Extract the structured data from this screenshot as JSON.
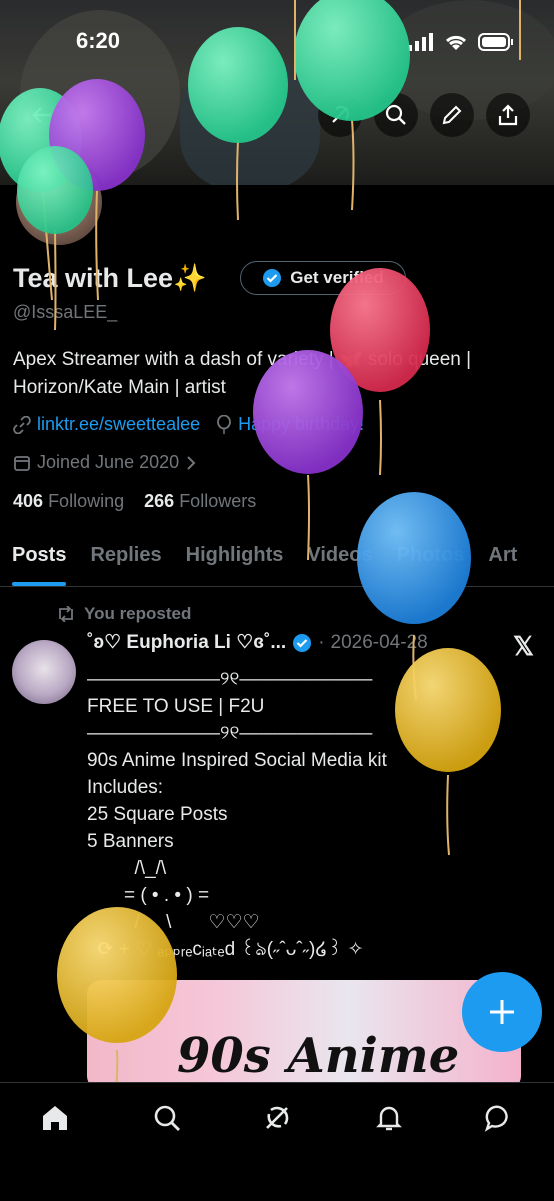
{
  "status_bar": {
    "time": "6:20"
  },
  "profile": {
    "name": "Tea with Lee✨",
    "handle": "@IsssaLEE_",
    "verify_button": "Get verified",
    "bio": "Apex Streamer with a dash of variety | 🦋 solo queen | Horizon/Kate Main | artist",
    "link": "linktr.ee/sweettealee",
    "birthday": "Happy birthday!",
    "joined": "Joined June 2020",
    "following_count": "406",
    "following_label": "Following",
    "followers_count": "266",
    "followers_label": "Followers"
  },
  "tabs": [
    "Posts",
    "Replies",
    "Highlights",
    "Videos",
    "Photos",
    "Art"
  ],
  "post": {
    "repost_label": "You reposted",
    "author": "˚ʚ♡ Euphoria Li ♡ɞ˚...",
    "date": "2026-04-28",
    "body": "———————୨୧———————\nFREE TO USE | F2U\n———————୨୧———————\n90s Anime Inspired Social Media kit\nIncludes:\n25 Square Posts\n5 Banners\n         /\\_/\\\n       = ( • . • ) =\n         /     \\       ♡♡♡\n  ⟳ + ♡ ₐₚₚᵣₑcᵢₐₜₑd ꒰ঌ(˶ˆᴗˆ˶)໒꒱ ✧",
    "image_title": "90s Anime"
  },
  "icons": [
    "back-arrow-icon",
    "grok-icon",
    "search-icon",
    "pencil-icon",
    "share-icon",
    "link-icon",
    "balloon-icon",
    "calendar-icon",
    "repost-icon",
    "verified-badge-icon",
    "x-logo-icon",
    "plus-icon",
    "home-icon",
    "explore-icon",
    "grok-nav-icon",
    "bell-icon",
    "messages-icon"
  ],
  "colors": {
    "accent": "#1d9bf0",
    "background": "#000000",
    "muted": "#71767b",
    "text": "#e7e9ea"
  }
}
